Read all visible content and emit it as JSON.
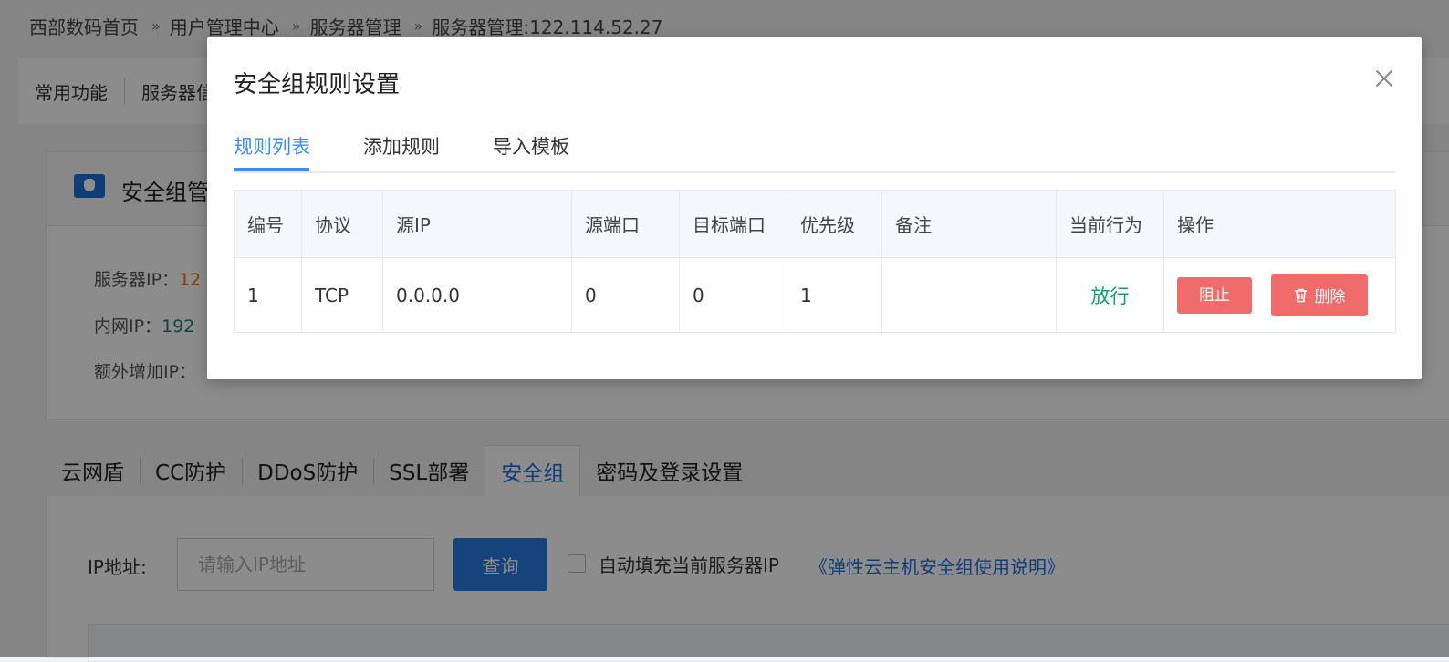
{
  "breadcrumb": [
    "西部数码首页",
    "用户管理中心",
    "服务器管理",
    "服务器管理:122.114.52.27"
  ],
  "topnav": [
    "常用功能",
    "服务器信"
  ],
  "panel": {
    "title": "安全组管",
    "server_ip_label": "服务器IP：",
    "server_ip_value": "12",
    "intranet_ip_label": "内网IP：",
    "intranet_ip_value": "192",
    "extra_ip_label": "额外增加IP："
  },
  "bottom_tabs": [
    "云网盾",
    "CC防护",
    "DDoS防护",
    "SSL部署",
    "安全组",
    "密码及登录设置"
  ],
  "search": {
    "label": "IP地址:",
    "placeholder": "请输入IP地址",
    "query_button": "查询",
    "checkbox_label": "自动填充当前服务器IP",
    "doc_link": "《弹性云主机安全组使用说明》"
  },
  "modal": {
    "title": "安全组规则设置",
    "tabs": [
      "规则列表",
      "添加规则",
      "导入模板"
    ],
    "active_tab": "规则列表",
    "columns": [
      "编号",
      "协议",
      "源IP",
      "源端口",
      "目标端口",
      "优先级",
      "备注",
      "当前行为",
      "操作"
    ],
    "rows": [
      {
        "id": "1",
        "protocol": "TCP",
        "source_ip": "0.0.0.0",
        "source_port": "0",
        "target_port": "0",
        "priority": "1",
        "remark": "",
        "action": "放行",
        "block_button": "阻止",
        "delete_button": "删除"
      }
    ]
  },
  "colors": {
    "accent_blue": "#3d8ee8",
    "allow_green": "#1a9c6b",
    "danger_red": "#f06b6b",
    "primary_button": "#2a7ae2"
  }
}
